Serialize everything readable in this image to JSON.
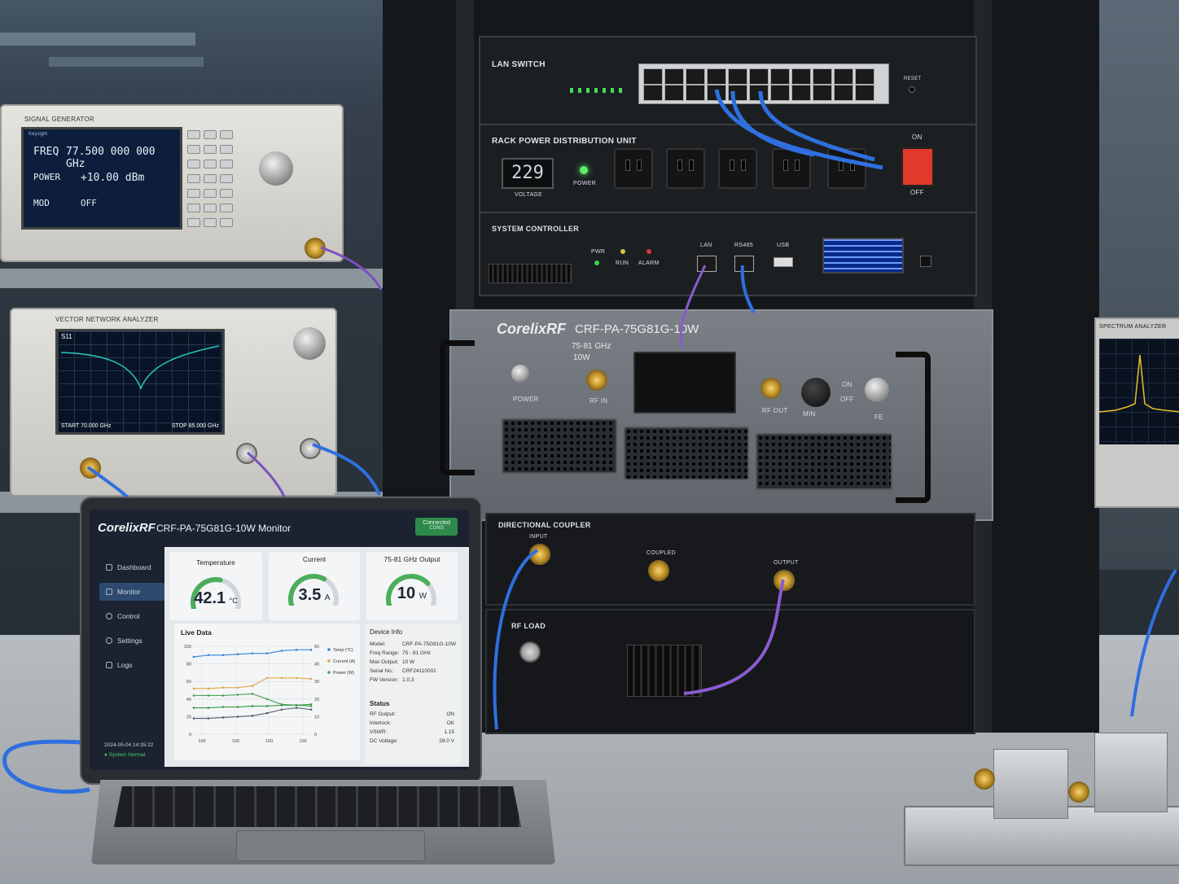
{
  "signal_generator": {
    "label": "SIGNAL GENERATOR",
    "brand": "Keysight",
    "freq_key": "FREQ",
    "freq_value": "77.500 000 000 GHz",
    "power_key": "POWER",
    "power_value": "+10.00 dBm",
    "mod_key": "MOD",
    "mod_value": "OFF"
  },
  "vna": {
    "label": "VECTOR NETWORK ANALYZER",
    "trace": "S11",
    "start": "START 70.000 GHz",
    "stop": "STOP 85.000 GHz"
  },
  "lan_switch": {
    "label": "LAN SWITCH",
    "reset": "RESET"
  },
  "pdu": {
    "label": "RACK POWER DISTRIBUTION UNIT",
    "voltage_value": "229",
    "voltage_label": "VOLTAGE",
    "power_label": "POWER",
    "on": "ON",
    "off": "OFF"
  },
  "controller": {
    "label": "SYSTEM CONTROLLER",
    "pwr": "PWR",
    "run": "RUN",
    "alarm": "ALARM",
    "lan": "LAN",
    "rs485": "RS485",
    "usb": "USB"
  },
  "amplifier": {
    "brand": "CorelixRF",
    "model": "CRF-PA-75G81G-10W",
    "freq": "75-81 GHz",
    "power": "10W",
    "power_label": "POWER",
    "rf_in": "RF IN",
    "rf_out": "RF OUT",
    "min": "MIN",
    "on": "ON",
    "off": "OFF",
    "fe": "FE"
  },
  "coupler": {
    "label": "DIRECTIONAL COUPLER",
    "input": "INPUT",
    "coupled": "COUPLED",
    "output": "OUTPUT"
  },
  "rf_load": {
    "label": "RF LOAD"
  },
  "spectrum": {
    "label": "SPECTRUM ANALYZER"
  },
  "monitor_app": {
    "brand": "CorelixRF",
    "title": "CRF-PA-75G81G-10W Monitor",
    "status_badge": "Connected",
    "status_sub": "COM3",
    "nav": [
      "Dashboard",
      "Monitor",
      "Control",
      "Settings",
      "Logs"
    ],
    "timestamp": "2024-05-04 14:35:22",
    "system_status": "● System Normal",
    "temperature": {
      "title": "Temperature",
      "value": "42.1",
      "unit": "°C",
      "fraction": 0.55
    },
    "current": {
      "title": "Current",
      "value": "3.5",
      "unit": "A",
      "fraction": 0.62
    },
    "output": {
      "title": "75-81 GHz Output",
      "value": "10",
      "unit": "W",
      "fraction": 0.7
    },
    "live_title": "Live Data",
    "device_info": {
      "title": "Device Info",
      "rows": [
        [
          "Model:",
          "CRF-PA-75G81G-10W"
        ],
        [
          "Freq Range:",
          "75 - 81 GHz"
        ],
        [
          "Max Output:",
          "10 W"
        ],
        [
          "Serial No.:",
          "CRF24110001"
        ],
        [
          "FW Version:",
          "1.0.3"
        ]
      ]
    },
    "status": {
      "title": "Status",
      "rows": [
        [
          "RF Output:",
          "ON"
        ],
        [
          "Interlock:",
          "OK"
        ],
        [
          "VSWR:",
          "1.15"
        ],
        [
          "DC Voltage:",
          "28.0 V"
        ]
      ]
    }
  },
  "chart_data": {
    "type": "line",
    "title": "Live Data",
    "x": [
      1,
      2,
      3,
      4,
      5,
      6,
      7,
      8,
      9
    ],
    "x_tick_labels": [
      "100",
      "100",
      "100",
      "100"
    ],
    "y_tick_labels_left": [
      "100",
      "80",
      "60",
      "40",
      "20",
      "0"
    ],
    "y_tick_labels_right": [
      "50",
      "40",
      "30",
      "20",
      "10",
      "0"
    ],
    "ylim": [
      0,
      100
    ],
    "series": [
      {
        "name": "Temp (°C)",
        "color": "#3b82d6",
        "values": [
          88,
          90,
          90,
          91,
          92,
          92,
          95,
          96,
          96
        ]
      },
      {
        "name": "Current (A)",
        "color": "#e2a53a",
        "values": [
          52,
          52,
          53,
          53,
          55,
          64,
          64,
          64,
          63
        ]
      },
      {
        "name": "Power (W)",
        "color": "#4aa35a",
        "values": [
          44,
          44,
          44,
          45,
          46,
          40,
          34,
          33,
          32
        ]
      },
      {
        "name": "",
        "color": "#3a9a4a",
        "values": [
          30,
          30,
          31,
          31,
          32,
          32,
          33,
          33,
          34
        ]
      },
      {
        "name": "",
        "color": "#556070",
        "values": [
          18,
          18,
          19,
          20,
          21,
          24,
          28,
          30,
          28
        ]
      }
    ],
    "legend_placement": "right",
    "grid": true
  }
}
